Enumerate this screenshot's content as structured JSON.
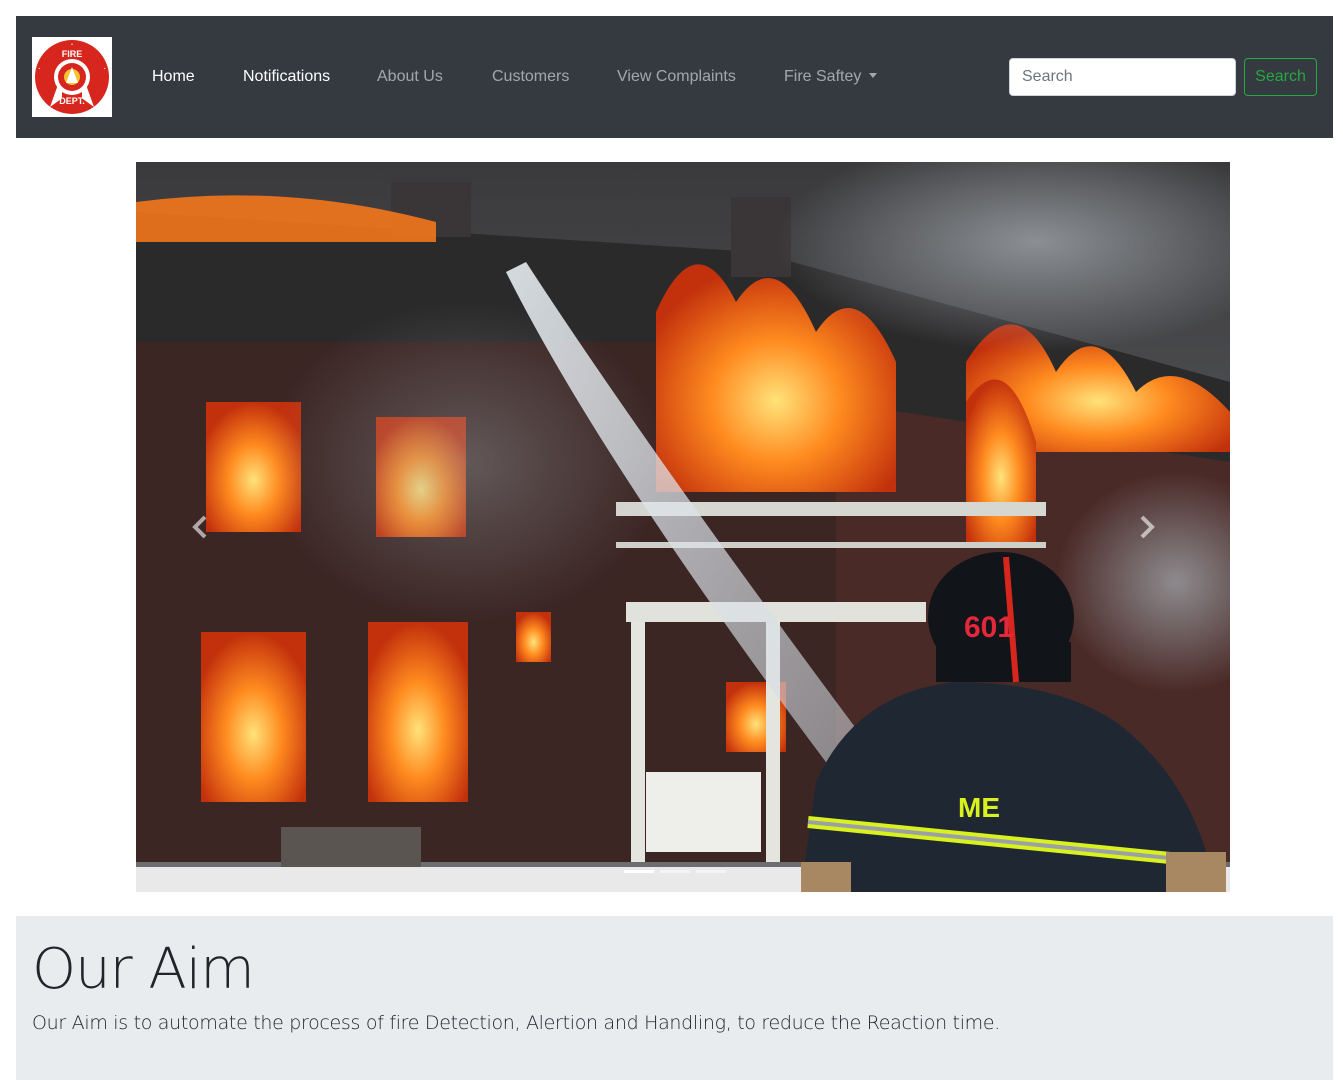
{
  "navbar": {
    "brand_logo_text_top": "FIRE",
    "brand_logo_text_bottom": "DEPT.",
    "items": [
      {
        "label": "Home",
        "active": true
      },
      {
        "label": "Notifications",
        "active": true
      },
      {
        "label": "About Us",
        "active": false
      },
      {
        "label": "Customers",
        "active": false
      },
      {
        "label": "View Complaints",
        "active": false
      },
      {
        "label": "Fire Saftey",
        "active": false,
        "dropdown": true
      }
    ],
    "search": {
      "placeholder": "Search",
      "value": "",
      "button_label": "Search"
    }
  },
  "carousel": {
    "slide_count": 3,
    "active_slide": 1,
    "helmet_number": "601",
    "jacket_text": "ME"
  },
  "jumbotron": {
    "title": "Our Aim",
    "text": "Our Aim is to automate the process of fire Detection, Alertion and Handling, to reduce the Reaction time."
  },
  "colors": {
    "navbar_bg": "#343a40",
    "search_button": "#28a745",
    "jumbotron_bg": "#e9ecef",
    "logo_red": "#d7261e"
  },
  "icons": {
    "brand": "fire-department-logo",
    "prev": "chevron-left-icon",
    "next": "chevron-right-icon",
    "dropdown": "caret-down-icon"
  }
}
